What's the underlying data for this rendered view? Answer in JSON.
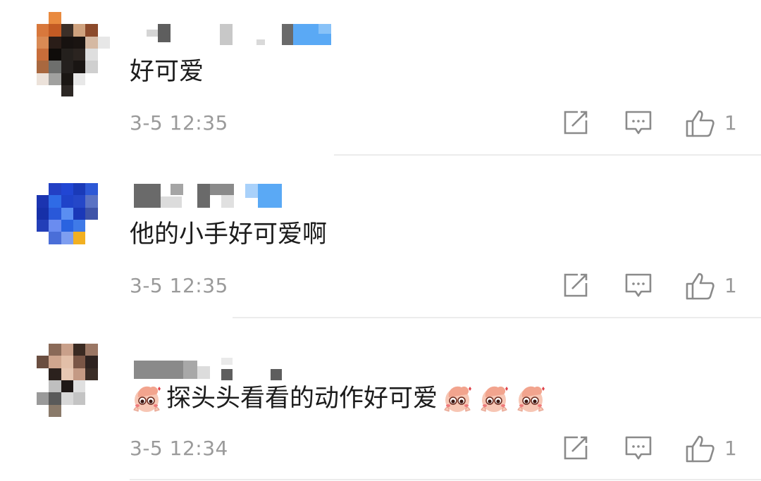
{
  "comments": [
    {
      "text": "好可爱",
      "time": "3-5 12:35",
      "likes": "1",
      "trailing_emoji_count": 0,
      "leading_emoji": false
    },
    {
      "text": "他的小手好可爱啊",
      "time": "3-5 12:35",
      "likes": "1",
      "trailing_emoji_count": 0,
      "leading_emoji": false
    },
    {
      "text": "探头头看看的动作好可爱",
      "time": "3-5 12:34",
      "likes": "1",
      "trailing_emoji_count": 3,
      "leading_emoji": true
    }
  ],
  "icons": {
    "share": "share-icon",
    "reply": "reply-icon",
    "like": "thumbs-up-icon",
    "emoji": "peeking-face-emoji-icon"
  },
  "colors": {
    "text": "#1c1c1c",
    "meta": "#9a9a9a",
    "divider": "#ececec",
    "accent_blue": "#5aa9f5"
  }
}
